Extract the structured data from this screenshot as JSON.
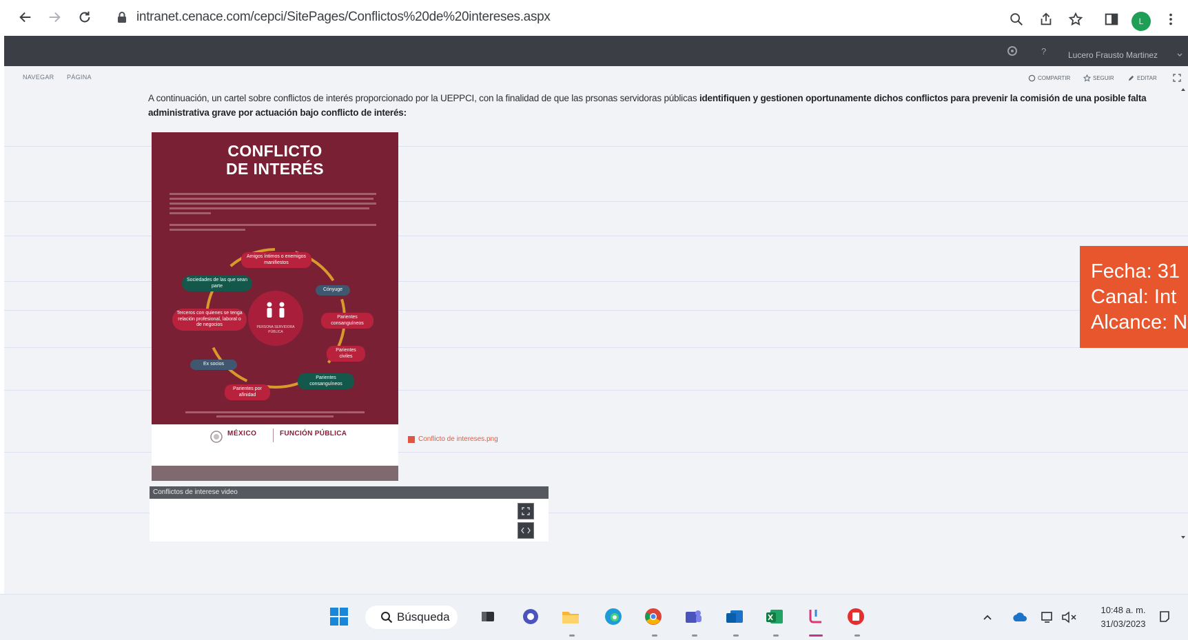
{
  "browser": {
    "url": "intranet.cenace.com/cepci/SitePages/Conflictos%20de%20intereses.aspx",
    "profile_initials": "L"
  },
  "suitebar": {
    "user_name": "Lucero Frausto Martinez"
  },
  "ribbon": {
    "tab_browse": "NAVEGAR",
    "tab_page": "PÁGINA",
    "action_share": "COMPARTIR",
    "action_follow": "SEGUIR",
    "action_edit": "EDITAR"
  },
  "intro": {
    "text_plain": "A continuación, un cartel sobre conflictos de interés proporcionado por la UEPPCI, con la finalidad de que las prsonas servidoras públicas ",
    "text_bold": "identifiquen y gestionen oportunamente dichos conflictos para prevenir la comisión de una posible falta administrativa grave por actuación bajo conflicto de interés:"
  },
  "poster": {
    "title_line1": "CONFLICTO",
    "title_line2": "DE INTERÉS",
    "logo_left": "MÉXICO",
    "logo_right": "FUNCIÓN PÚBLICA",
    "pills": {
      "friends": "Amigos íntimos o enemigos manifiestos",
      "spouse": "Cónyuge",
      "societies": "Sociedades de las que sean parte",
      "relatives": "Parientes consanguíneos",
      "third": "Terceros con quienes se tenga relación profesional, laboral o de negocios",
      "center": "PERSONA SERVIDORA PÚBLICA",
      "civil": "Parientes civiles",
      "partner": "Ex socios",
      "consanguineous": "Parientes consanguíneos",
      "affinity": "Parientes por afinidad"
    }
  },
  "attachment": {
    "label": "Conflicto de intereses.png"
  },
  "video": {
    "title": "Conflictos de interese video"
  },
  "overlay": {
    "line1": "Fecha: 31",
    "line2": "Canal: Int",
    "line3": "Alcance: N"
  },
  "taskbar": {
    "search_label": "Búsqueda",
    "time": "10:48 a. m.",
    "date": "31/03/2023"
  },
  "colors": {
    "poster_maroon": "#7a2035",
    "overlay_orange": "#e8562e",
    "suitebar_dark": "#3b3f45"
  }
}
